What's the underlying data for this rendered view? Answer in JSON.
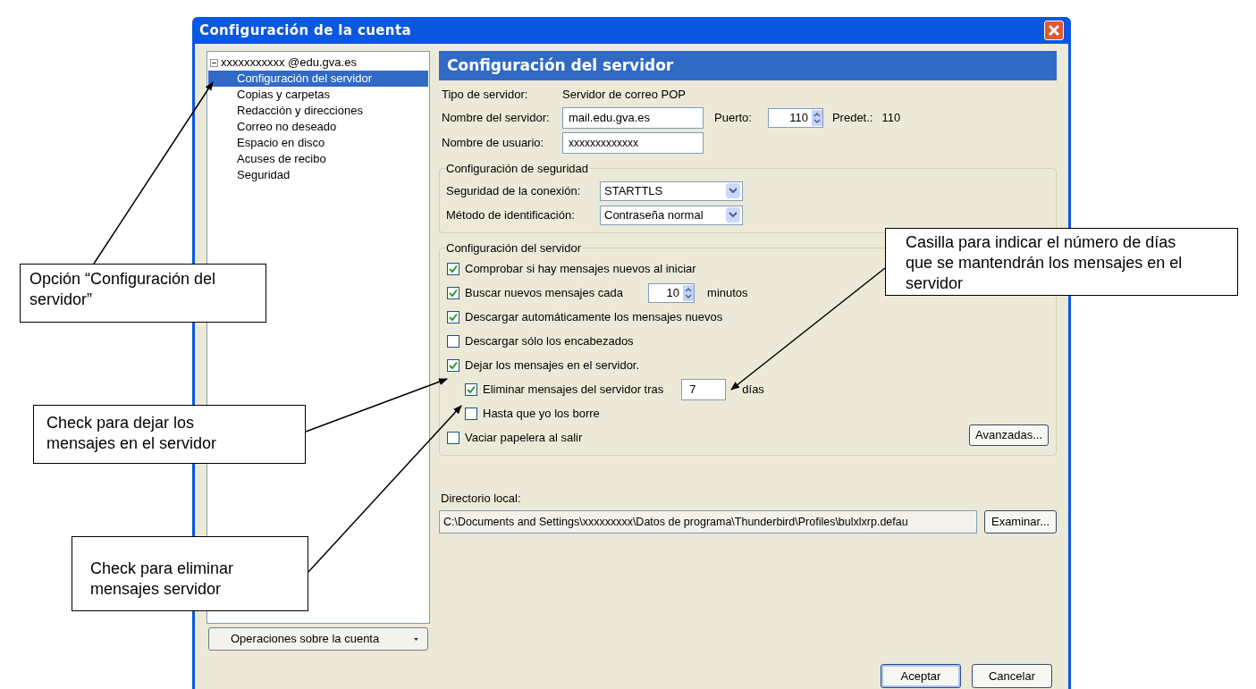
{
  "window": {
    "title": "Configuración de la cuenta"
  },
  "tree": {
    "account": "xxxxxxxxxxx @edu.gva.es",
    "expanded": true,
    "items": [
      {
        "label": "Configuración del servidor",
        "selected": true
      },
      {
        "label": "Copias y carpetas",
        "selected": false
      },
      {
        "label": "Redacción y direcciones",
        "selected": false
      },
      {
        "label": "Correo no deseado",
        "selected": false
      },
      {
        "label": "Espacio en disco",
        "selected": false
      },
      {
        "label": "Acuses de recibo",
        "selected": false
      },
      {
        "label": "Seguridad",
        "selected": false
      }
    ]
  },
  "account_actions_button": "Operaciones sobre la cuenta",
  "panel": {
    "heading": "Configuración del servidor",
    "server_type": {
      "label": "Tipo de servidor:",
      "value": "Servidor de correo POP"
    },
    "server_name": {
      "label": "Nombre del servidor:",
      "value": "mail.edu.gva.es"
    },
    "port": {
      "label": "Puerto:",
      "value": "110",
      "default_label": "Predet.:",
      "default_value": "110"
    },
    "username": {
      "label": "Nombre de usuario:",
      "value": "xxxxxxxxxxxxx"
    },
    "security": {
      "title": "Configuración de seguridad",
      "fields": [
        {
          "label": "Seguridad de la conexión:",
          "value": "STARTTLS"
        },
        {
          "label": "Método de identificación:",
          "value": "Contraseña normal"
        }
      ]
    },
    "server_settings": {
      "title": "Configuración del servidor",
      "options": [
        {
          "kind": "check",
          "label": "Comprobar si hay mensajes nuevos al iniciar",
          "checked": true
        },
        {
          "kind": "spin",
          "label": "Buscar nuevos mensajes cada",
          "checked": true,
          "value": "10",
          "unit": "minutos"
        },
        {
          "kind": "check",
          "label": "Descargar automáticamente los mensajes nuevos",
          "checked": true
        },
        {
          "kind": "check",
          "label": "Descargar sólo los encabezados",
          "checked": false
        },
        {
          "kind": "check",
          "label": "Dejar los mensajes en el servidor.",
          "checked": true,
          "children": [
            {
              "kind": "field",
              "label": "Eliminar mensajes del servidor tras",
              "checked": true,
              "value": "7",
              "unit": "días"
            },
            {
              "kind": "check",
              "label": "Hasta que yo los borre",
              "checked": false
            }
          ]
        },
        {
          "kind": "check",
          "label": "Vaciar papelera al salir",
          "checked": false
        }
      ],
      "advanced_button": "Avanzadas..."
    },
    "local_dir": {
      "label": "Directorio local:",
      "value": "C:\\Documents and Settings\\xxxxxxxxx\\Datos de programa\\Thunderbird\\Profiles\\bulxlxrp.defau",
      "button": "Examinar..."
    }
  },
  "buttons": [
    {
      "label": "Aceptar",
      "default": true
    },
    {
      "label": "Cancelar",
      "default": false
    }
  ],
  "callouts": [
    {
      "text": "Opción “Configuración del servidor”"
    },
    {
      "text": "Casilla para indicar el número de días que se mantendrán los mensajes en el servidor"
    },
    {
      "text": "Check para dejar los mensajes en el servidor"
    },
    {
      "text": "Check para eliminar mensajes servidor"
    }
  ]
}
